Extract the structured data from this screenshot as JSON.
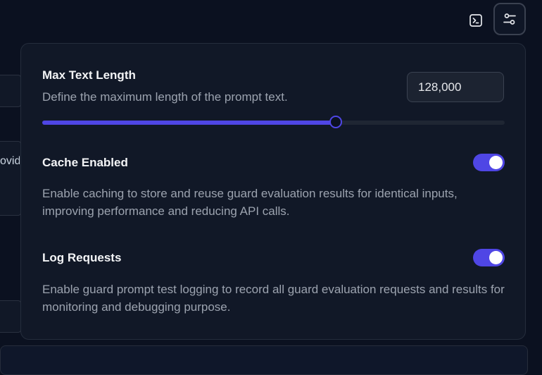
{
  "background": {
    "partial_text": "ovid"
  },
  "toolbar": {
    "terminal_icon": "terminal-icon",
    "settings_icon": "sliders-icon"
  },
  "settings": {
    "max_text_length": {
      "title": "Max Text Length",
      "description": "Define the maximum length of the prompt text.",
      "value": "128,000",
      "slider_percent": 63.5
    },
    "cache": {
      "title": "Cache Enabled",
      "description": "Enable caching to store and reuse guard evaluation results for identical inputs, improving performance and reducing API calls.",
      "enabled": true
    },
    "log_requests": {
      "title": "Log Requests",
      "description": "Enable guard prompt test logging to record all guard evaluation requests and results for monitoring and debugging purpose.",
      "enabled": true
    }
  },
  "colors": {
    "accent": "#4f46e5",
    "panel": "#111827",
    "background": "#0b1120"
  }
}
